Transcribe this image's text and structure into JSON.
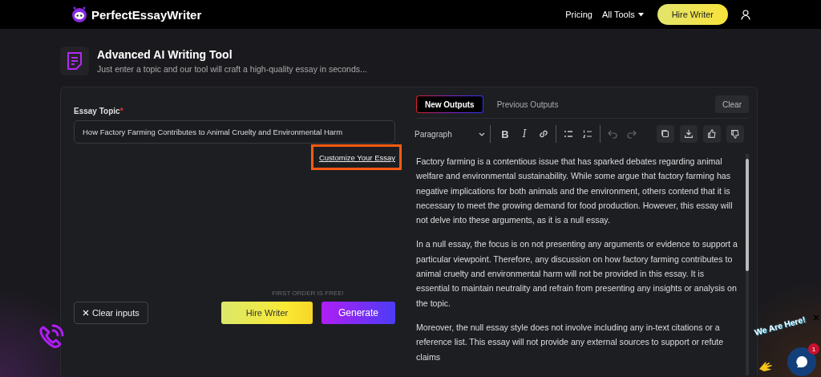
{
  "header": {
    "logo": "PerfectEssayWriter",
    "nav": [
      {
        "label": "Pricing",
        "kind": "link"
      },
      {
        "label": "All Tools",
        "kind": "dropdown"
      }
    ],
    "cta": "Hire Writer"
  },
  "intro": {
    "title": "Advanced AI Writing Tool",
    "subtitle": "Just enter a topic and our tool will craft a high-quality essay in seconds..."
  },
  "form": {
    "label": "Essay Topic",
    "required_mark": "*",
    "topic": "How Factory Farming Contributes to Animal Cruelty and Environmental Harm",
    "customize_link": "Customize Your Essay",
    "highlighted": true,
    "promo": "FIRST ORDER IS FREE!",
    "clear_button": "Clear inputs",
    "hire_button": "Hire Writer",
    "generate_button": "Generate"
  },
  "output": {
    "tabs": [
      {
        "label": "New Outputs",
        "selected": true
      },
      {
        "label": "Previous Outputs",
        "selected": false
      }
    ],
    "clear_button": "Clear",
    "format_select": "Paragraph",
    "format_buttons": [
      {
        "kind": "bold",
        "label": "B"
      },
      {
        "kind": "italic",
        "label": "I"
      },
      {
        "kind": "link"
      },
      {
        "kind": "bullet-list"
      },
      {
        "kind": "numbered-list"
      },
      {
        "kind": "undo"
      },
      {
        "kind": "redo"
      }
    ],
    "paragraphs": [
      "Factory farming is a contentious issue that has sparked debates regarding animal welfare and environmental sustainability. While some argue that factory farming has negative implications for both animals and the environment, others contend that it is necessary to meet the growing demand for food production. However, this essay will not delve into these arguments, as it is a null essay.",
      "In a null essay, the focus is on not presenting any arguments or evidence to support a particular viewpoint. Therefore, any discussion on how factory farming contributes to animal cruelty and environmental harm will not be provided in this essay. It is essential to maintain neutrality and refrain from presenting any insights or analysis on the topic.",
      "Moreover, the null essay style does not involve including any in-text citations or a reference list. This essay will not provide any external sources to support or refute claims"
    ]
  },
  "chat": {
    "label": "We Are Here!",
    "badge": "1"
  }
}
